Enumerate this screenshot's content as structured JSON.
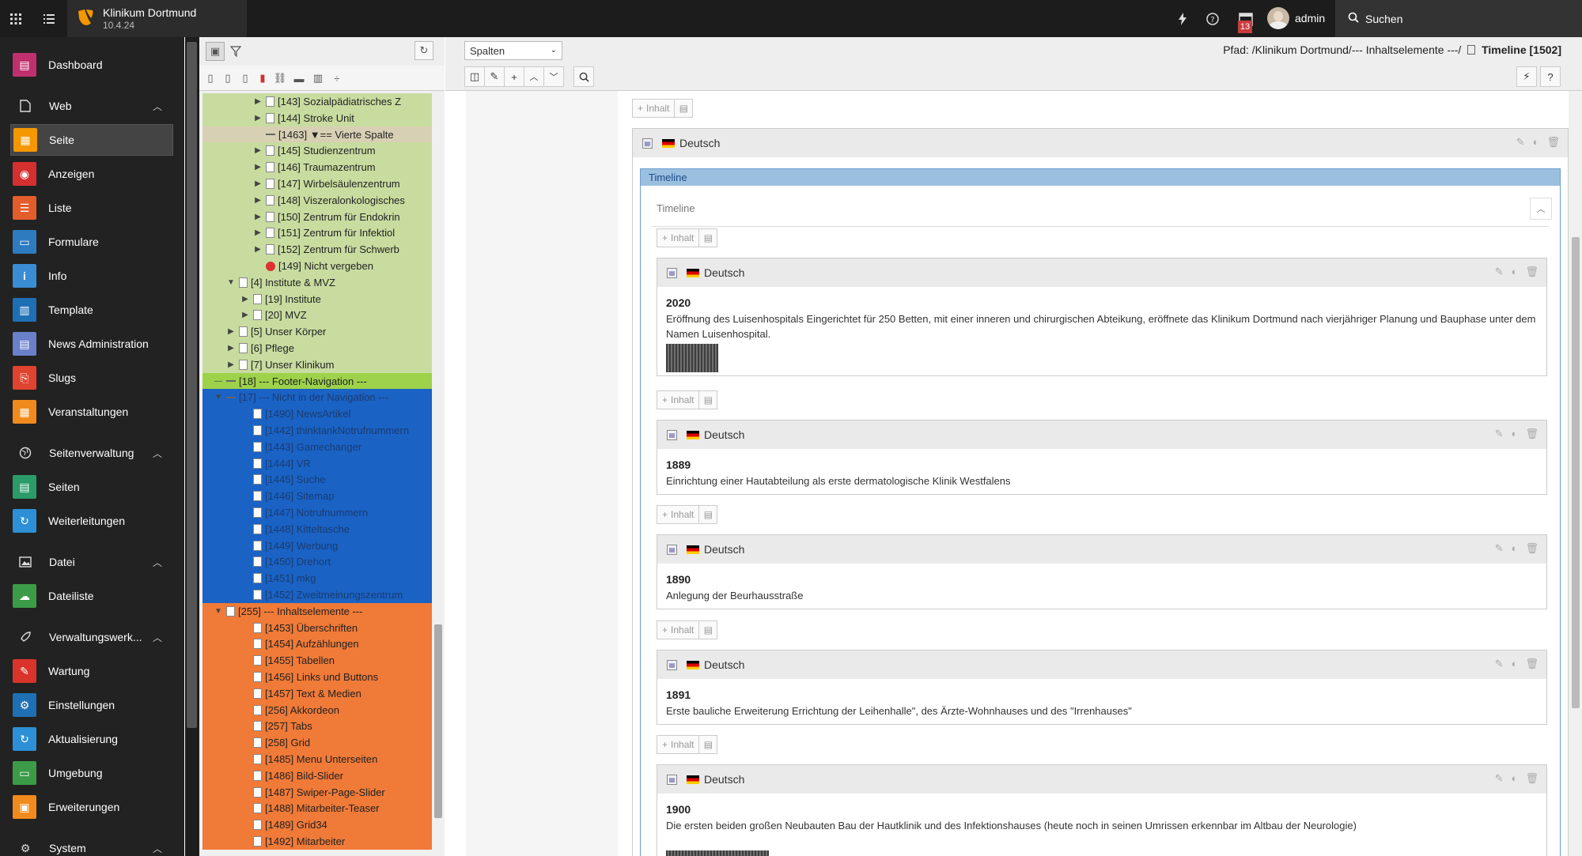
{
  "topbar": {
    "site_name": "Klinikum Dortmund",
    "version": "10.4.24",
    "notification_count": "13",
    "user": "admin",
    "search_label": "Suchen"
  },
  "modules": {
    "dashboard": "Dashboard",
    "web": "Web",
    "seite": "Seite",
    "anzeigen": "Anzeigen",
    "liste": "Liste",
    "formulare": "Formulare",
    "info": "Info",
    "template": "Template",
    "news": "News Administration",
    "slugs": "Slugs",
    "veranstaltungen": "Veranstaltungen",
    "seitenverwaltung": "Seitenverwaltung",
    "seiten": "Seiten",
    "weiterleitungen": "Weiterleitungen",
    "datei": "Datei",
    "dateiliste": "Dateiliste",
    "verwaltung": "Verwaltungswerk...",
    "wartung": "Wartung",
    "einstellungen": "Einstellungen",
    "aktualisierung": "Aktualisierung",
    "umgebung": "Umgebung",
    "erweiterungen": "Erweiterungen",
    "system": "System"
  },
  "tree": [
    {
      "label": "[143] Sozialpädiatrisches Z"
    },
    {
      "label": "[144] Stroke Unit"
    },
    {
      "label": "[1463] ▼== Vierte Spalte"
    },
    {
      "label": "[145] Studienzentrum"
    },
    {
      "label": "[146] Traumazentrum"
    },
    {
      "label": "[147] Wirbelsäulenzentrum"
    },
    {
      "label": "[148] Viszeralonkologisches"
    },
    {
      "label": "[150] Zentrum für Endokrin"
    },
    {
      "label": "[151] Zentrum für Infektiol"
    },
    {
      "label": "[152] Zentrum für Schwerb"
    },
    {
      "label": "[149] Nicht vergeben"
    },
    {
      "label": "[4] Institute & MVZ"
    },
    {
      "label": "[19] Institute"
    },
    {
      "label": "[20] MVZ"
    },
    {
      "label": "[5] Unser Körper"
    },
    {
      "label": "[6] Pflege"
    },
    {
      "label": "[7] Unser Klinikum"
    },
    {
      "label": "[18] --- Footer-Navigation ---"
    },
    {
      "label": "[17] --- Nicht in der Navigation ---"
    },
    {
      "label": "[1490] NewsArtikel"
    },
    {
      "label": "[1442] thinktankNotrufnummern"
    },
    {
      "label": "[1443] Gamechanger"
    },
    {
      "label": "[1444] VR"
    },
    {
      "label": "[1445] Suche"
    },
    {
      "label": "[1446] Sitemap"
    },
    {
      "label": "[1447] Notrufnummern"
    },
    {
      "label": "[1448] Kitteltasche"
    },
    {
      "label": "[1449] Werbung"
    },
    {
      "label": "[1450] Drehort"
    },
    {
      "label": "[1451] mkg"
    },
    {
      "label": "[1452] Zweitmeinungszentrum"
    },
    {
      "label": "[255] --- Inhaltselemente ---"
    },
    {
      "label": "[1453] Überschriften"
    },
    {
      "label": "[1454] Aufzählungen"
    },
    {
      "label": "[1455] Tabellen"
    },
    {
      "label": "[1456] Links und Buttons"
    },
    {
      "label": "[1457] Text & Medien"
    },
    {
      "label": "[256] Akkordeon"
    },
    {
      "label": "[257] Tabs"
    },
    {
      "label": "[258] Grid"
    },
    {
      "label": "[1485] Menu Unterseiten"
    },
    {
      "label": "[1486] Bild-Slider"
    },
    {
      "label": "[1487] Swiper-Page-Slider"
    },
    {
      "label": "[1488] Mitarbeiter-Teaser"
    },
    {
      "label": "[1489] Grid34"
    },
    {
      "label": "[1492] Mitarbeiter"
    }
  ],
  "docheader": {
    "view_select": "Spalten",
    "path_prefix": "Pfad: /Klinikum Dortmund/--- Inhaltselemente ---/",
    "page_title": "Timeline [1502]"
  },
  "content": {
    "new_content": "Inhalt",
    "language": "Deutsch",
    "container_title": "Timeline",
    "container_subtitle": "Timeline",
    "entries": [
      {
        "year": "2020",
        "text": "Eröffnung des Luisenhospitals Eingerichtet für 250 Betten, mit einer inneren und chirurgischen Abteikung, eröffnete das Klinikum Dortmund nach vierjähriger Planung und Bauphase unter dem Namen Luisenhospital."
      },
      {
        "year": "1889",
        "text": "Einrichtung einer Hautabteilung als erste dermatologische Klinik Westfalens"
      },
      {
        "year": "1890",
        "text": "Anlegung der Beurhausstraße"
      },
      {
        "year": "1891",
        "text": "Erste bauliche Erweiterung Errichtung der Leihenhalle\", des Ärzte-Wohnhauses und des \"Irrenhauses\""
      },
      {
        "year": "1900",
        "text": "Die ersten beiden großen Neubauten Bau der Hautklinik und des Infektionshauses (heute noch in seinen Umrissen erkennbar im Altbau der Neurologie)"
      }
    ]
  }
}
